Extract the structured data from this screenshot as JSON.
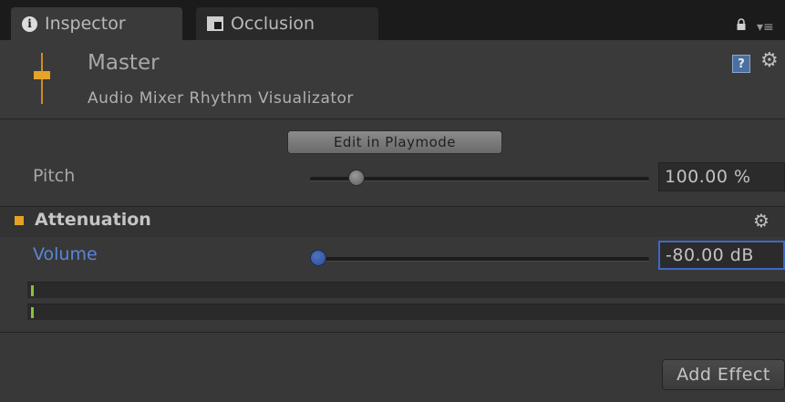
{
  "tabs": [
    {
      "label": "Inspector",
      "icon": "info-icon",
      "active": true
    },
    {
      "label": "Occlusion",
      "icon": "occlusion-icon",
      "active": false
    }
  ],
  "header": {
    "title": "Master",
    "subtitle": "Audio Mixer Rhythm Visualizator",
    "help_icon_text": "?"
  },
  "edit_button_label": "Edit in Playmode",
  "pitch": {
    "label": "Pitch",
    "value": "100.00 %",
    "slider_fraction": 0.12
  },
  "attenuation": {
    "title": "Attenuation",
    "volume_label": "Volume",
    "volume_value": "-80.00 dB",
    "slider_fraction": 0.0
  },
  "meters": [
    {
      "level_fraction": 0.0
    },
    {
      "level_fraction": 0.0
    }
  ],
  "add_effect_label": "Add Effect",
  "colors": {
    "accent": "#e5a126",
    "focus_blue": "#3e67c8",
    "meter_green": "#8bc13b"
  }
}
